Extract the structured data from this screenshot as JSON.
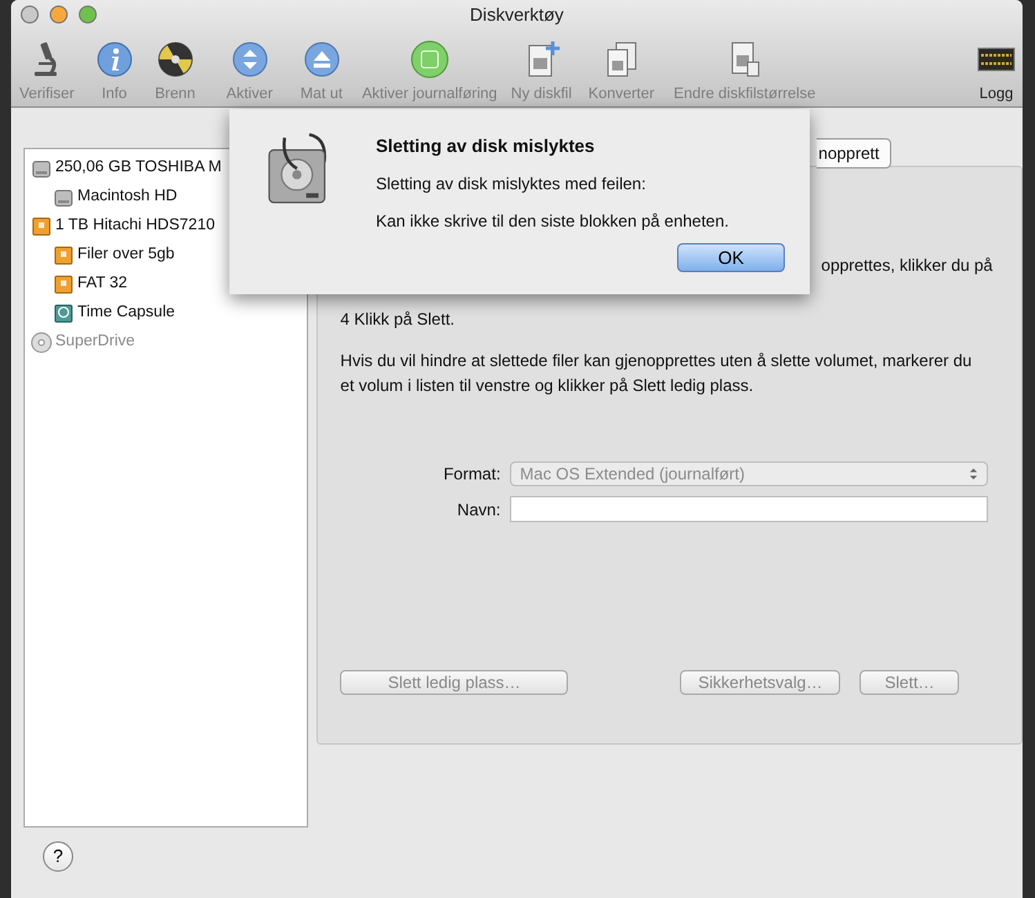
{
  "window": {
    "title": "Diskverktøy"
  },
  "toolbar": [
    {
      "label": "Verifiser",
      "kind": "microscope",
      "disabled": true
    },
    {
      "label": "Info",
      "kind": "info",
      "disabled": true
    },
    {
      "label": "Brenn",
      "kind": "burn",
      "disabled": true
    },
    {
      "label": "Aktiver",
      "kind": "mount",
      "disabled": true
    },
    {
      "label": "Mat ut",
      "kind": "eject",
      "disabled": true
    },
    {
      "label": "Aktiver journalføring",
      "kind": "journal",
      "disabled": true
    },
    {
      "label": "Ny diskfil",
      "kind": "newimage",
      "disabled": true
    },
    {
      "label": "Konverter",
      "kind": "convert",
      "disabled": true
    },
    {
      "label": "Endre diskfilstørrelse",
      "kind": "resize",
      "disabled": true
    },
    {
      "label": "Logg",
      "kind": "log",
      "disabled": false
    }
  ],
  "sidebar": {
    "items": [
      {
        "label": "250,06 GB TOSHIBA M",
        "kind": "disk",
        "disabled": false,
        "children": [
          {
            "label": "Macintosh HD",
            "kind": "disk",
            "disabled": false
          }
        ]
      },
      {
        "label": "1 TB Hitachi HDS7210",
        "kind": "external",
        "disabled": false,
        "children": [
          {
            "label": "Filer over 5gb",
            "kind": "external",
            "disabled": false
          },
          {
            "label": "FAT 32",
            "kind": "external",
            "disabled": false
          },
          {
            "label": "Time Capsule",
            "kind": "timecapsule",
            "disabled": false
          }
        ]
      },
      {
        "label": "SuperDrive",
        "kind": "optical",
        "disabled": true
      }
    ]
  },
  "panel": {
    "tabs": [
      {
        "label": "nopprett",
        "selected": false
      }
    ],
    "partial_lines": [
      "opprettes, klikker du på",
      "4 Klikk på Slett."
    ],
    "paragraph": "Hvis du vil hindre at slettede filer kan gjenopprettes uten å slette volumet, markerer du et volum i listen til venstre og klikker på Slett ledig plass.",
    "form": [
      {
        "label": "Format:",
        "kind": "select",
        "value": "Mac OS Extended (journalført)",
        "disabled": true
      },
      {
        "label": "Navn:",
        "kind": "text"
      }
    ],
    "buttons": [
      {
        "label": "Slett ledig plass…",
        "disabled": true
      },
      {
        "label": "Sikkerhetsvalg…",
        "disabled": true
      },
      {
        "label": "Slett…",
        "disabled": true
      }
    ]
  },
  "dialog": {
    "title": "Sletting av disk mislyktes",
    "message": "Sletting av disk mislyktes med feilen:",
    "detail": "Kan ikke skrive til den siste blokken på enheten.",
    "button": "OK"
  },
  "help_button": "?"
}
